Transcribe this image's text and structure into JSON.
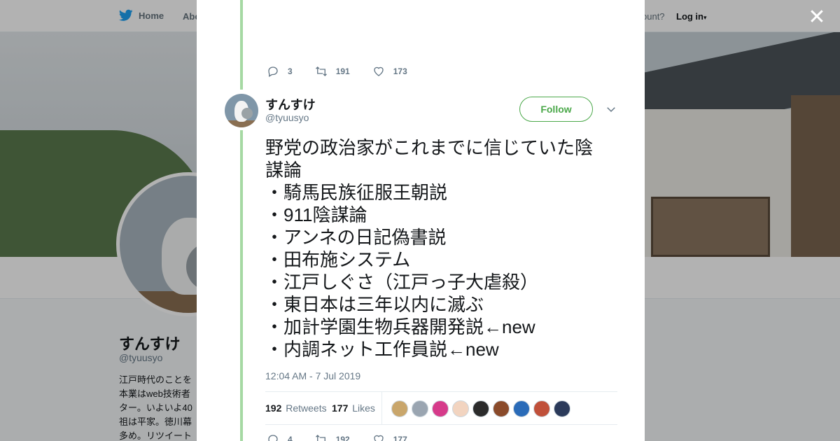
{
  "nav": {
    "home_label": "Home",
    "about_label": "Abo",
    "account_prompt": "ccount?",
    "login_label": "Log in"
  },
  "profile": {
    "name": "すんすけ",
    "handle": "@tyuusyo",
    "bio_lines": [
      "江戸時代のことを",
      "本業はweb技術者",
      "ター。いよいよ40",
      "祖は平家。徳川幕",
      "多め。リツイート"
    ]
  },
  "previous_tweet": {
    "replies": "3",
    "retweets": "191",
    "likes": "173"
  },
  "tweet": {
    "author_name": "すんすけ",
    "author_handle": "@tyuusyo",
    "follow_label": "Follow",
    "text_lines": [
      "野党の政治家がこれまでに信じていた陰",
      "謀論",
      "・騎馬民族征服王朝説",
      "・911陰謀論",
      "・アンネの日記偽書説",
      "・田布施システム",
      "・江戸しぐさ（江戸っ子大虐殺）",
      "・東日本は三年以内に滅ぶ",
      "・加計学園生物兵器開発説←new",
      "・内調ネット工作員説←new"
    ],
    "timestamp": "12:04 AM - 7 Jul 2019",
    "retweet_count": "192",
    "retweet_label": "Retweets",
    "like_count": "177",
    "like_label": "Likes",
    "liker_colors": [
      "#c9a66b",
      "#9aa5b1",
      "#d63a8a",
      "#f2d4c0",
      "#2b2b2b",
      "#8a4a2a",
      "#2a6bb8",
      "#c0503a",
      "#2b3a5a"
    ]
  },
  "next_tweet": {
    "replies": "4",
    "retweets": "192",
    "likes": "177"
  },
  "colors": {
    "accent_green": "#4ba84a",
    "thread_line": "#a6d9a3",
    "twitter_blue": "#1da1f2"
  },
  "icons": {
    "close": "close-icon",
    "reply": "reply-icon",
    "retweet": "retweet-icon",
    "like": "heart-icon",
    "caret": "chevron-down-icon",
    "logo": "twitter-bird-icon"
  }
}
